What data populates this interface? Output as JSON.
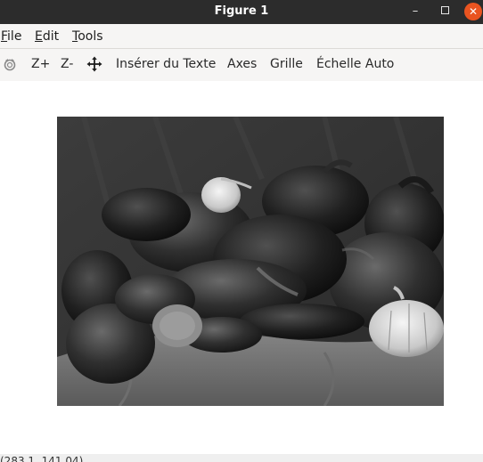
{
  "window": {
    "title": "Figure 1"
  },
  "menubar": {
    "items": [
      {
        "mnemonic": "F",
        "rest": "ile"
      },
      {
        "mnemonic": "E",
        "rest": "dit"
      },
      {
        "mnemonic": "T",
        "rest": "ools"
      }
    ]
  },
  "toolbar": {
    "rotate_icon": "rotate-icon",
    "zoom_in_label": "Z+",
    "zoom_out_label": "Z-",
    "pan_icon": "pan-arrows-icon",
    "insert_text_label": "Insérer du Texte",
    "axes_label": "Axes",
    "grid_label": "Grille",
    "autoscale_label": "Échelle Auto"
  },
  "figure": {
    "image_subject": "grayscale photo of peppers, onion and garlic on a draped cloth"
  },
  "statusbar": {
    "coords": "(283.1, 141.04)"
  },
  "colors": {
    "titlebar": "#2c2c2c",
    "close_button": "#e95420",
    "toolbar_bg": "#f6f5f4"
  }
}
